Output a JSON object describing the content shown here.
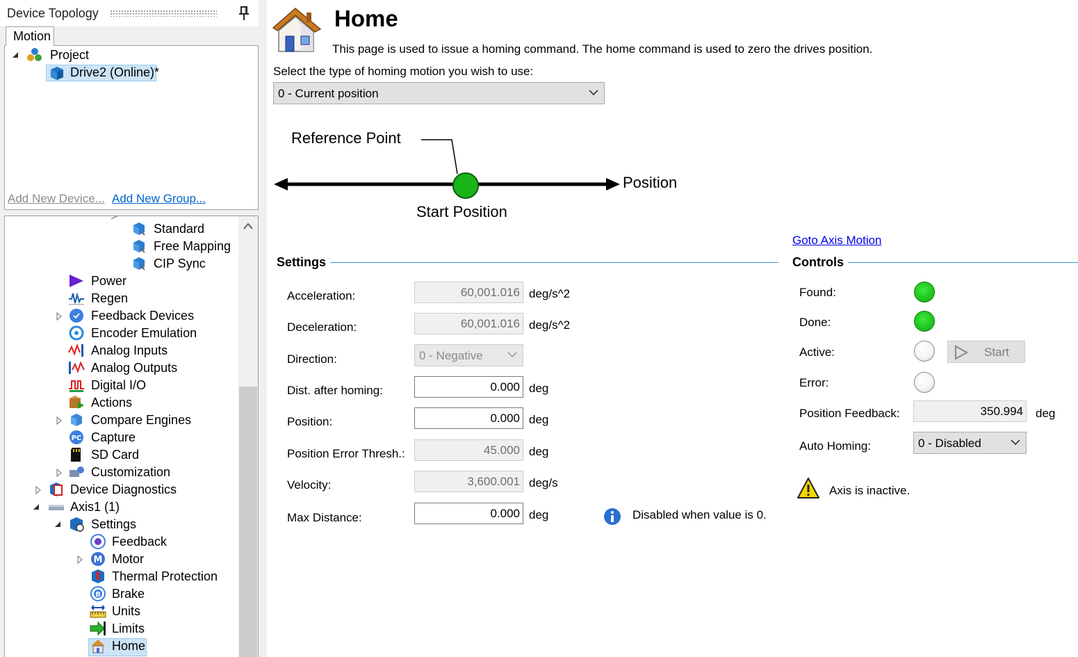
{
  "sidebar": {
    "title": "Device Topology",
    "tab": "Motion",
    "project_tree": [
      {
        "label": "Project"
      },
      {
        "label": "Drive2 (Online)*"
      }
    ],
    "links": {
      "add_device": "Add New Device...",
      "add_group": "Add New Group..."
    },
    "nav_tree": [
      {
        "label": "Standard"
      },
      {
        "label": "Free Mapping"
      },
      {
        "label": "CIP Sync"
      },
      {
        "label": "Power"
      },
      {
        "label": "Regen"
      },
      {
        "label": "Feedback Devices"
      },
      {
        "label": "Encoder Emulation"
      },
      {
        "label": "Analog Inputs"
      },
      {
        "label": "Analog Outputs"
      },
      {
        "label": "Digital I/O"
      },
      {
        "label": "Actions"
      },
      {
        "label": "Compare Engines"
      },
      {
        "label": "Capture"
      },
      {
        "label": "SD Card"
      },
      {
        "label": "Customization"
      },
      {
        "label": "Device Diagnostics"
      },
      {
        "label": "Axis1 (1)"
      },
      {
        "label": "Settings"
      },
      {
        "label": "Feedback"
      },
      {
        "label": "Motor"
      },
      {
        "label": "Thermal Protection"
      },
      {
        "label": "Brake"
      },
      {
        "label": "Units"
      },
      {
        "label": "Limits"
      },
      {
        "label": "Home"
      }
    ]
  },
  "main": {
    "title": "Home",
    "description": "This page is used to issue a homing command. The home command is used to zero the drives position.",
    "homing_type_label": "Select the type of homing motion you wish to use:",
    "homing_type_value": "0 - Current position",
    "diagram": {
      "reference_point": "Reference Point",
      "position": "Position",
      "start_position": "Start Position"
    },
    "goto_link": "Goto Axis Motion",
    "settings": {
      "title": "Settings",
      "acceleration": {
        "label": "Acceleration:",
        "value": "60,001.016",
        "unit": "deg/s^2"
      },
      "deceleration": {
        "label": "Deceleration:",
        "value": "60,001.016",
        "unit": "deg/s^2"
      },
      "direction": {
        "label": "Direction:",
        "value": "0 - Negative"
      },
      "dist_after_homing": {
        "label": "Dist. after homing:",
        "value": "0.000",
        "unit": "deg"
      },
      "position": {
        "label": "Position:",
        "value": "0.000",
        "unit": "deg"
      },
      "position_error_thresh": {
        "label": "Position Error Thresh.:",
        "value": "45.000",
        "unit": "deg"
      },
      "velocity": {
        "label": "Velocity:",
        "value": "3,600.001",
        "unit": "deg/s"
      },
      "max_distance": {
        "label": "Max Distance:",
        "value": "0.000",
        "unit": "deg"
      },
      "max_distance_hint": "Disabled when value is 0."
    },
    "controls": {
      "title": "Controls",
      "found_label": "Found:",
      "done_label": "Done:",
      "active_label": "Active:",
      "error_label": "Error:",
      "start_button": "Start",
      "position_feedback": {
        "label": "Position Feedback:",
        "value": "350.994",
        "unit": "deg"
      },
      "auto_homing": {
        "label": "Auto Homing:",
        "value": "0 - Disabled"
      },
      "status_message": "Axis is inactive."
    }
  },
  "colors": {
    "selection": "#cce4f7",
    "link": "#0000ee",
    "section_line": "#3b8ed0",
    "led_on": "#1fc41f",
    "diagram_dot": "#19b419"
  }
}
